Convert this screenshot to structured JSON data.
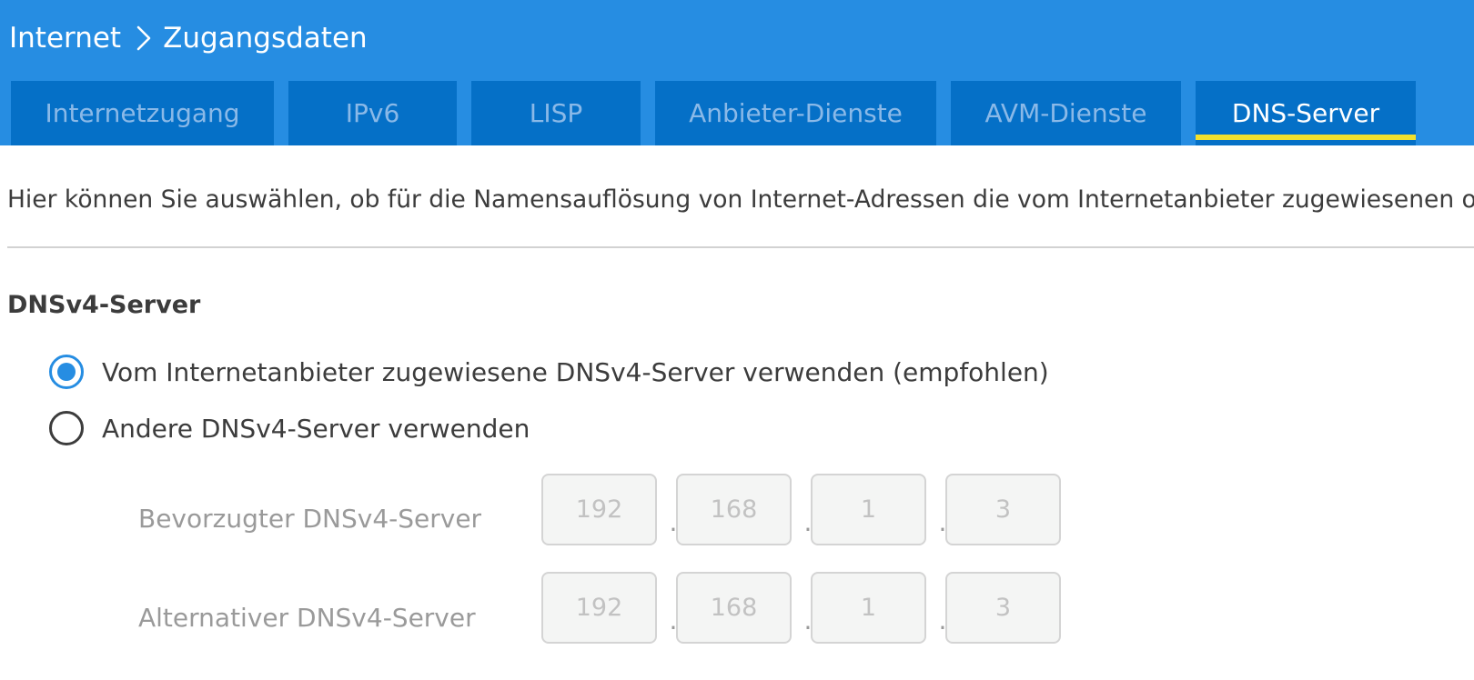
{
  "breadcrumb": {
    "parent": "Internet",
    "current": "Zugangsdaten",
    "separator_icon": "chevron-right-icon"
  },
  "tabs": [
    {
      "label": "Internetzugang",
      "active": false
    },
    {
      "label": "IPv6",
      "active": false
    },
    {
      "label": "LISP",
      "active": false
    },
    {
      "label": "Anbieter-Dienste",
      "active": false
    },
    {
      "label": "AVM-Dienste",
      "active": false
    },
    {
      "label": "DNS-Server",
      "active": true
    }
  ],
  "intro_text": "Hier können Sie auswählen, ob für die Namensauflösung von Internet-Adressen die vom Internetanbieter zugewiesenen o",
  "dnsv4": {
    "title": "DNSv4-Server",
    "options": [
      {
        "label": "Vom Internetanbieter zugewiesene DNSv4-Server verwenden (empfohlen)",
        "checked": true
      },
      {
        "label": "Andere DNSv4-Server verwenden",
        "checked": false
      }
    ],
    "preferred": {
      "label": "Bevorzugter DNSv4-Server",
      "octets": [
        "192",
        "168",
        "1",
        "3"
      ]
    },
    "alternative": {
      "label": "Alternativer DNSv4-Server",
      "octets": [
        "192",
        "168",
        "1",
        "3"
      ]
    },
    "octet_separator": "."
  },
  "colors": {
    "header_bg": "#268de2",
    "tab_bg": "#0570c7",
    "tab_text": "#8ab9e8",
    "tab_active_text": "#ffffff",
    "tab_active_underline": "#f3e02c",
    "radio_checked": "#268de2"
  }
}
